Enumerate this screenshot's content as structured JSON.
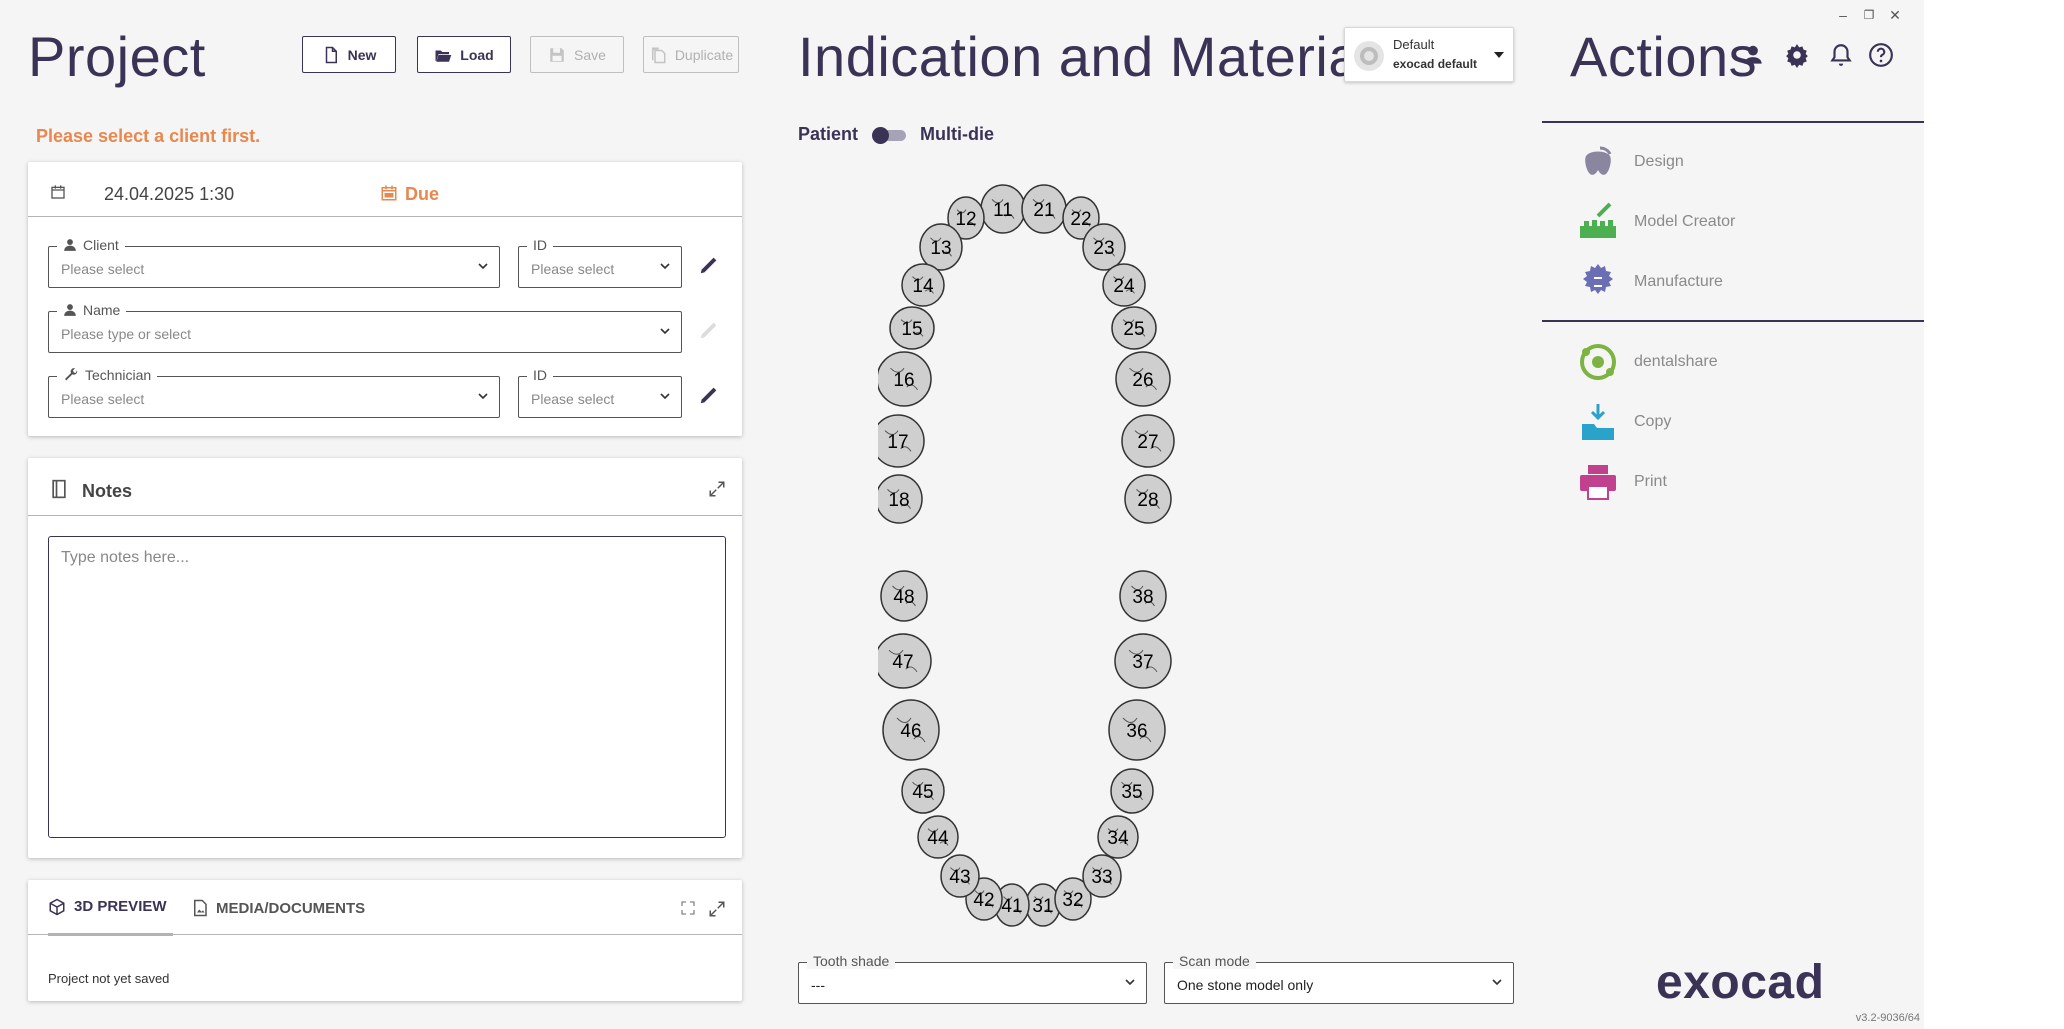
{
  "project": {
    "title": "Project",
    "buttons": {
      "new": "New",
      "load": "Load",
      "save": "Save",
      "duplicate": "Duplicate"
    },
    "warning": "Please select a client first.",
    "date": "24.04.2025 1:30",
    "due": "Due",
    "fields": {
      "client_label": "Client",
      "client_placeholder": "Please select",
      "client_id_label": "ID",
      "client_id_placeholder": "Please select",
      "name_label": "Name",
      "name_placeholder": "Please type or select",
      "technician_label": "Technician",
      "technician_placeholder": "Please select",
      "technician_id_label": "ID",
      "technician_id_placeholder": "Please select"
    },
    "notes": {
      "title": "Notes",
      "placeholder": "Type notes here..."
    },
    "preview": {
      "tab_3d": "3D PREVIEW",
      "tab_media": "MEDIA/DOCUMENTS",
      "status": "Project not yet saved"
    }
  },
  "indication": {
    "title": "Indication and Materials",
    "profile": {
      "name": "Default",
      "subtitle": "exocad default"
    },
    "toggle": {
      "left": "Patient",
      "right": "Multi-die"
    },
    "teeth": {
      "upper_right": [
        "11",
        "12",
        "13",
        "14",
        "15",
        "16",
        "17",
        "18"
      ],
      "upper_left": [
        "21",
        "22",
        "23",
        "24",
        "25",
        "26",
        "27",
        "28"
      ],
      "lower_left": [
        "31",
        "32",
        "33",
        "34",
        "35",
        "36",
        "37",
        "38"
      ],
      "lower_right": [
        "41",
        "42",
        "43",
        "44",
        "45",
        "46",
        "47",
        "48"
      ]
    },
    "tooth_shade": {
      "label": "Tooth shade",
      "value": "---"
    },
    "scan_mode": {
      "label": "Scan mode",
      "value": "One stone model only"
    }
  },
  "actions": {
    "title": "Actions",
    "items": [
      {
        "label": "Design",
        "icon": "design-icon",
        "color": "#8a86a0"
      },
      {
        "label": "Model Creator",
        "icon": "model-creator-icon",
        "color": "#4caf50"
      },
      {
        "label": "Manufacture",
        "icon": "manufacture-icon",
        "color": "#6a6fb5"
      },
      {
        "label": "dentalshare",
        "icon": "dentalshare-icon",
        "color": "#7cb342"
      },
      {
        "label": "Copy",
        "icon": "copy-icon",
        "color": "#29a3c9"
      },
      {
        "label": "Print",
        "icon": "print-icon",
        "color": "#c2418f"
      }
    ],
    "logo": "exocad",
    "version": "v3.2-9036/64"
  },
  "colors": {
    "accent": "#3b3355",
    "warning": "#e8884f",
    "tab_underline": "#e8a27a"
  }
}
